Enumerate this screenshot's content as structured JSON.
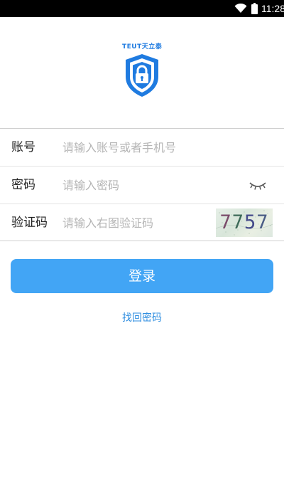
{
  "status_bar": {
    "time": "11:28",
    "wifi_icon": "wifi-icon",
    "battery_icon": "battery-icon"
  },
  "logo": {
    "brand_text": "TEUT天立泰",
    "icon": "shield-lock-icon",
    "color": "#1f7be0"
  },
  "form": {
    "account": {
      "label": "账号",
      "placeholder": "请输入账号或者手机号",
      "value": ""
    },
    "password": {
      "label": "密码",
      "placeholder": "请输入密码",
      "value": "",
      "toggle_icon": "eye-closed-icon"
    },
    "captcha": {
      "label": "验证码",
      "placeholder": "请输入右图验证码",
      "value": "",
      "image_text": "7757"
    }
  },
  "login_button": {
    "label": "登录",
    "color": "#42a5f5"
  },
  "recover_link": {
    "label": "找回密码",
    "color": "#2f8ee0"
  }
}
